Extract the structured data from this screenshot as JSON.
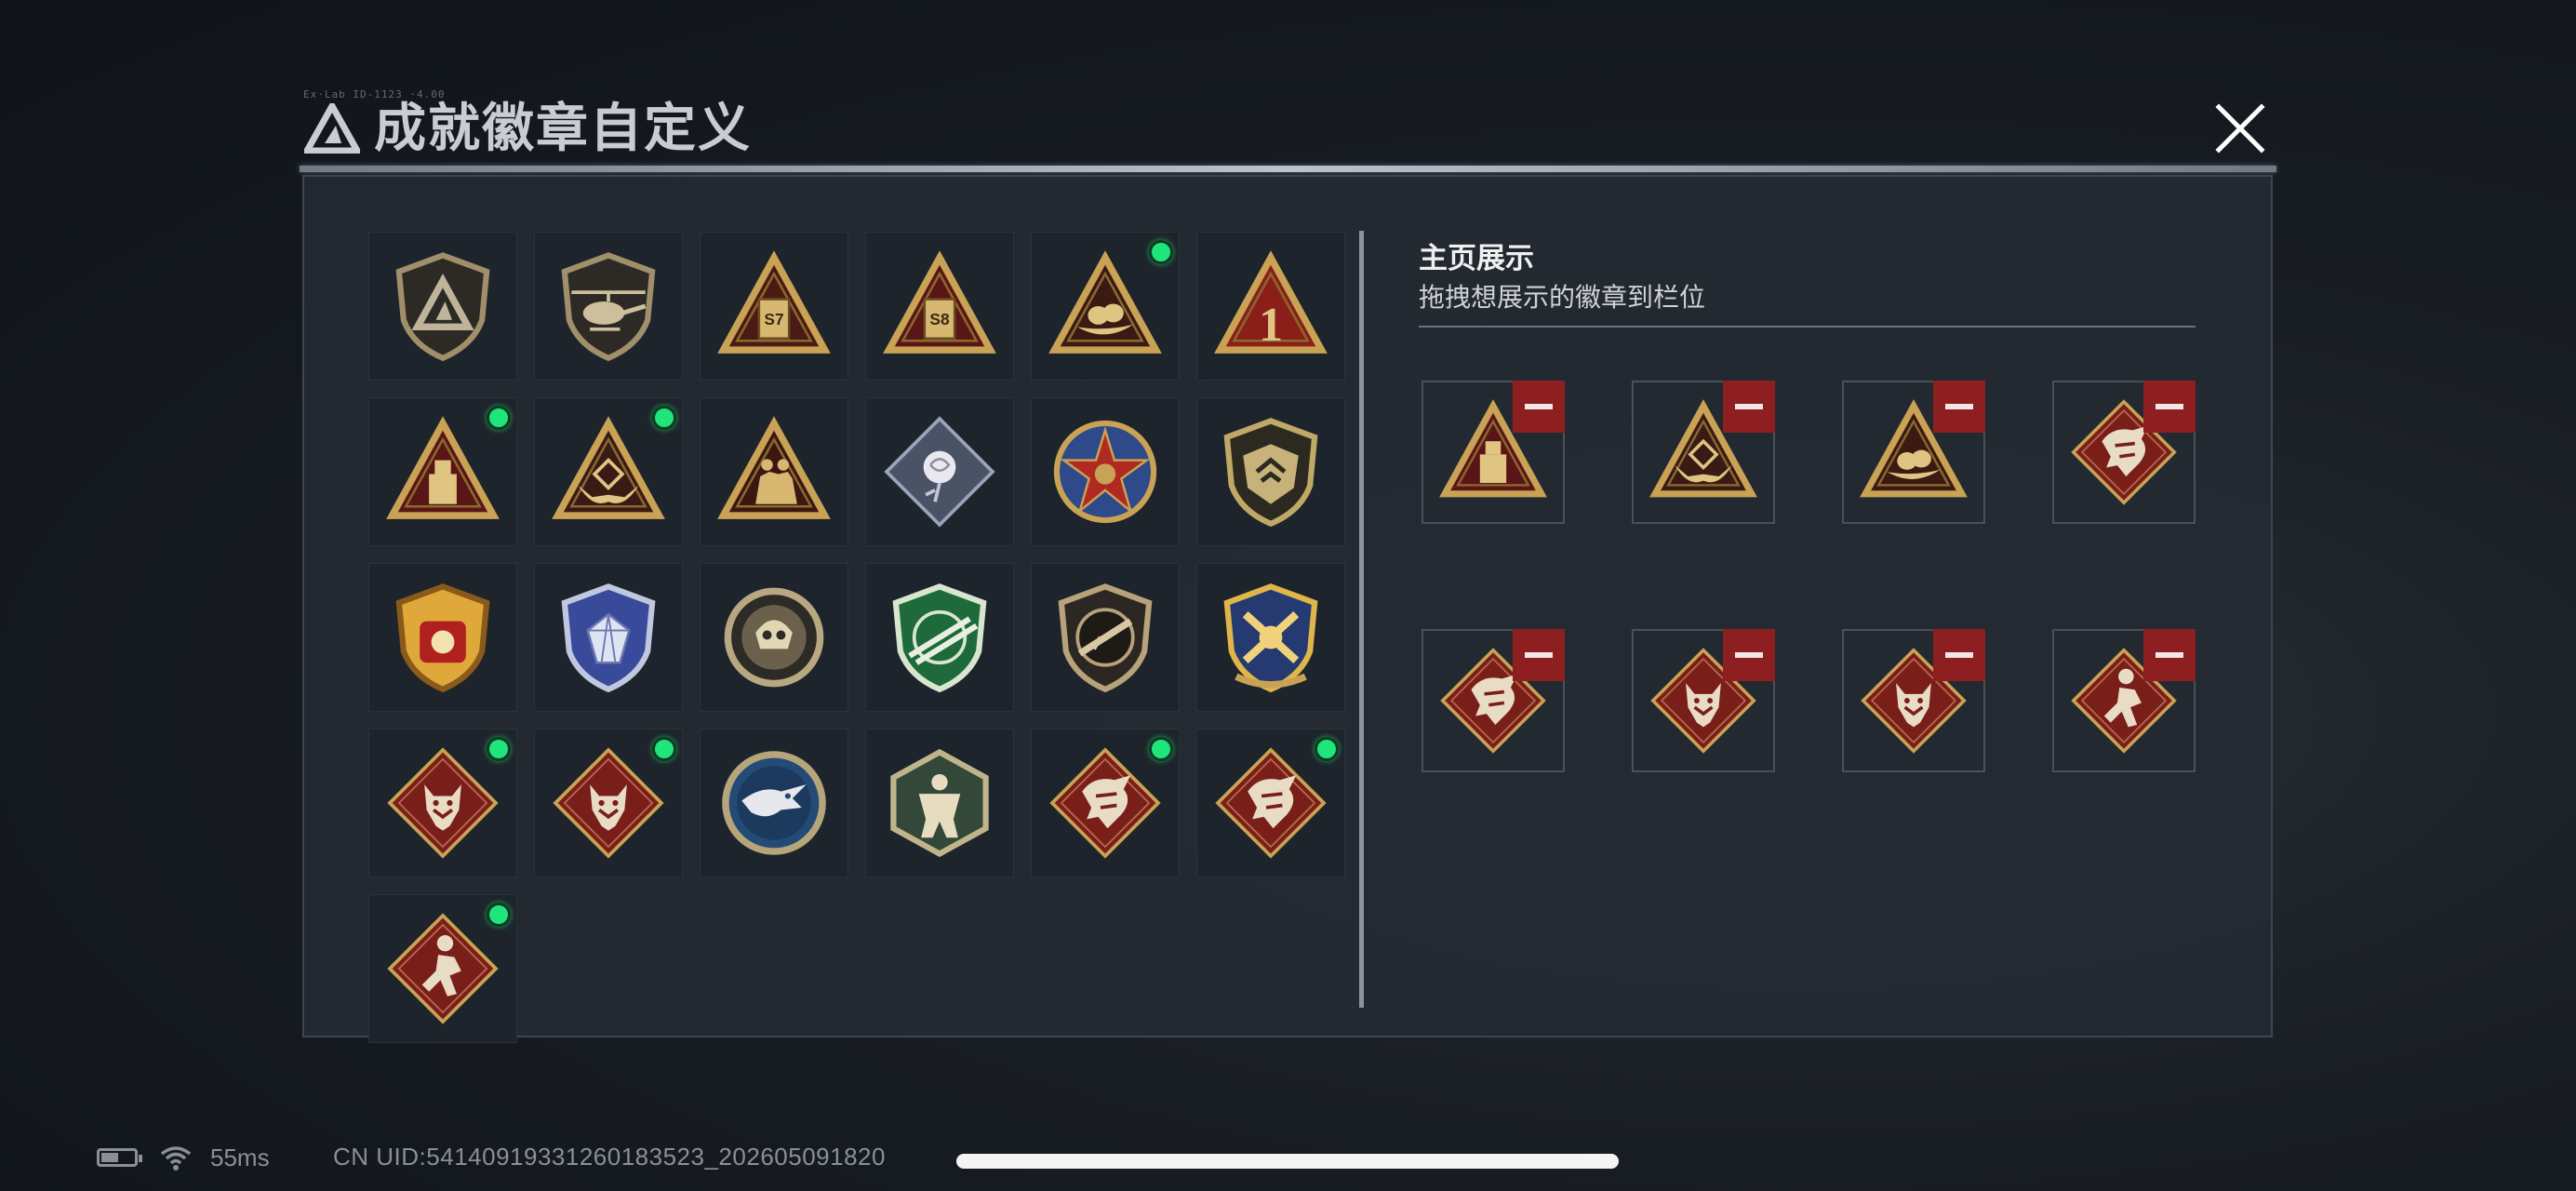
{
  "header": {
    "tiny_text": "Ex·Lab ID-1123 ·4.00",
    "title": "成就徽章自定义",
    "close_icon": "close-icon"
  },
  "colors": {
    "gold": "#c9a255",
    "red_bg": "#7a1e1a",
    "green_dot": "#1fe57b",
    "remove_red": "#8e1f20"
  },
  "badges": [
    {
      "icon": "shield-logo-badge",
      "dot": false
    },
    {
      "icon": "helicopter-badge",
      "dot": false
    },
    {
      "icon": "s7-triangle-badge",
      "dot": false,
      "text": "S7"
    },
    {
      "icon": "s8-triangle-badge",
      "dot": false,
      "text": "S8"
    },
    {
      "icon": "nest-triangle-badge",
      "dot": true
    },
    {
      "icon": "number-one-triangle-badge",
      "dot": false,
      "text": "1"
    },
    {
      "icon": "usb-triangle-badge",
      "dot": true
    },
    {
      "icon": "hands-triangle-badge",
      "dot": true
    },
    {
      "icon": "soldiers-triangle-badge",
      "dot": false
    },
    {
      "icon": "rose-diamond-badge",
      "dot": false
    },
    {
      "icon": "star-round-badge",
      "dot": false
    },
    {
      "icon": "tactical-shield-badge",
      "dot": false
    },
    {
      "icon": "stars-gold-shield-badge",
      "dot": false
    },
    {
      "icon": "gem-blue-shield-badge",
      "dot": false
    },
    {
      "icon": "skull-round-badge",
      "dot": false
    },
    {
      "icon": "rifle-green-shield-badge",
      "dot": false
    },
    {
      "icon": "rifle-shield-badge",
      "dot": false
    },
    {
      "icon": "crossed-gold-shield-badge",
      "dot": false
    },
    {
      "icon": "wolf-diamond-badge",
      "dot": true
    },
    {
      "icon": "wolf-diamond-badge",
      "dot": true
    },
    {
      "icon": "eagle-round-badge",
      "dot": false
    },
    {
      "icon": "strongman-hex-badge",
      "dot": false
    },
    {
      "icon": "dragon-diamond-badge",
      "dot": true
    },
    {
      "icon": "dragon-diamond-badge",
      "dot": true
    },
    {
      "icon": "runner-diamond-badge",
      "dot": true
    }
  ],
  "showcase": {
    "title": "主页展示",
    "subtitle": "拖拽想展示的徽章到栏位",
    "slots": [
      {
        "icon": "usb-triangle-badge"
      },
      {
        "icon": "hands-triangle-badge"
      },
      {
        "icon": "nest-triangle-badge"
      },
      {
        "icon": "dragon-diamond-badge"
      },
      {
        "icon": "dragon-diamond-badge"
      },
      {
        "icon": "wolf-diamond-badge"
      },
      {
        "icon": "wolf-diamond-badge"
      },
      {
        "icon": "runner-diamond-badge"
      }
    ]
  },
  "footer": {
    "ping": "55ms",
    "uid": "CN UID:54140919331260183523_202605091820"
  }
}
